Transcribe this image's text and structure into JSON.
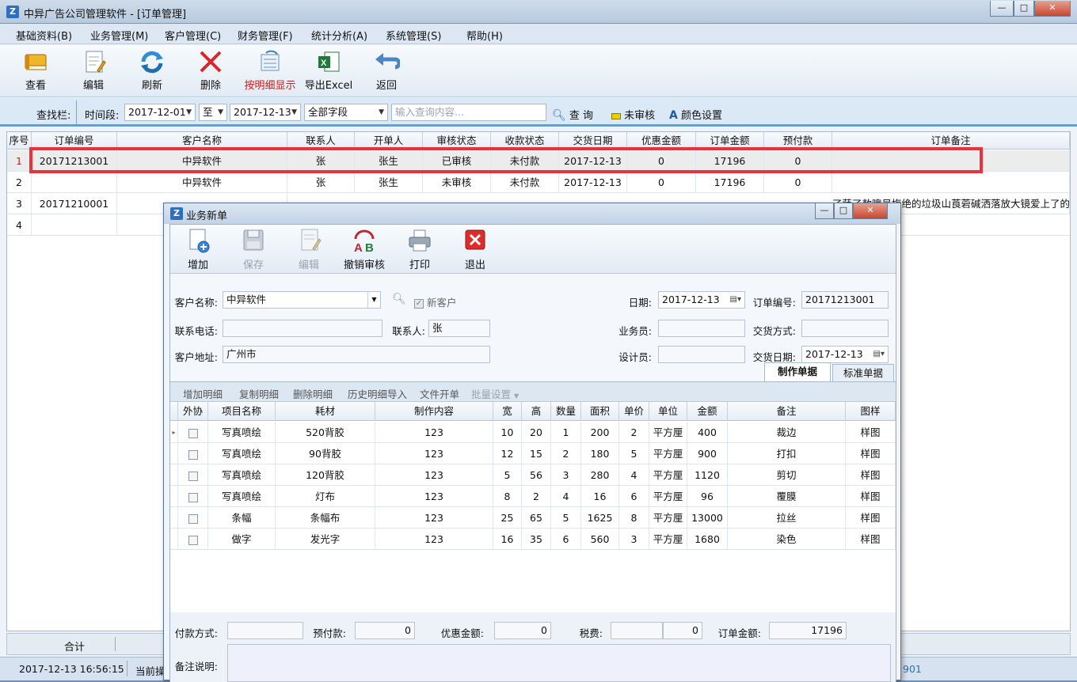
{
  "window": {
    "title": "中异广告公司管理软件 - [订单管理]",
    "app_icon": "Z",
    "btn_min": "—",
    "btn_max": "□",
    "btn_close": "✕"
  },
  "menu": [
    "基础资料(B)",
    "业务管理(M)",
    "客户管理(C)",
    "财务管理(F)",
    "统计分析(A)",
    "系统管理(S)",
    "帮助(H)"
  ],
  "toolbar": {
    "view": "查看",
    "edit": "编辑",
    "refresh": "刷新",
    "delete": "删除",
    "detail_show": "按明细显示",
    "export": "导出Excel",
    "back": "返回"
  },
  "search": {
    "bar_label": "查找栏:",
    "period_label": "时间段:",
    "date_from": "2017-12-01",
    "to_label": "至",
    "date_to": "2017-12-13",
    "field": "全部字段",
    "placeholder": "输入查询内容...",
    "query_btn": "查 询",
    "unreviewed": "未审核",
    "color_settings": "颜色设置"
  },
  "grid": {
    "headers": [
      "序号",
      "订单编号",
      "客户名称",
      "联系人",
      "开单人",
      "审核状态",
      "收款状态",
      "交货日期",
      "优惠金额",
      "订单金额",
      "预付款",
      "订单备注"
    ],
    "rows": [
      [
        "1",
        "20171213001",
        "中异软件",
        "张",
        "张生",
        "已审核",
        "未付款",
        "2017-12-13",
        "0",
        "17196",
        "0",
        ""
      ],
      [
        "2",
        "",
        "中异软件",
        "张",
        "张生",
        "未审核",
        "未付款",
        "2017-12-13",
        "0",
        "17196",
        "0",
        ""
      ],
      [
        "3",
        "20171210001",
        "",
        "",
        "",
        "",
        "",
        "",
        "",
        "",
        "",
        "了萨了敖噢吴梅绝的垃圾山莨菪碱洒落放大镜爱上了的"
      ],
      [
        "4",
        "",
        "",
        "",
        "",
        "",
        "",
        "",
        "",
        "",
        "",
        ""
      ]
    ],
    "sum_label": "合计"
  },
  "status": {
    "datetime": "2017-12-13 16:56:15",
    "current": "当前操",
    "right": "901"
  },
  "dialog": {
    "title": "业务新单",
    "toolbar": {
      "add": "增加",
      "save": "保存",
      "edit": "编辑",
      "cancel_review": "撤销审核",
      "print": "打印",
      "exit": "退出"
    },
    "form": {
      "customer_label": "客户名称:",
      "customer": "中异软件",
      "new_customer": "新客户",
      "date_label": "日期:",
      "date": "2017-12-13",
      "order_no_label": "订单编号:",
      "order_no": "20171213001",
      "phone_label": "联系电话:",
      "phone": "",
      "contact_label": "联系人:",
      "contact": "张",
      "sales_label": "业务员:",
      "sales": "",
      "delivery_method_label": "交货方式:",
      "delivery_method": "",
      "address_label": "客户地址:",
      "address": "广州市",
      "designer_label": "设计员:",
      "designer": "",
      "delivery_date_label": "交货日期:",
      "delivery_date": "2017-12-13"
    },
    "tabs": [
      "制作单据",
      "标准单据"
    ],
    "subtoolbar": [
      "增加明细",
      "复制明细",
      "删除明细",
      "历史明细导入",
      "文件开单",
      "批量设置"
    ],
    "detail_headers": [
      "外协",
      "项目名称",
      "耗材",
      "制作内容",
      "宽",
      "高",
      "数量",
      "面积",
      "单价",
      "单位",
      "金额",
      "备注",
      "图样"
    ],
    "detail_rows": [
      [
        "写真喷绘",
        "520背胶",
        "123",
        "10",
        "20",
        "1",
        "200",
        "2",
        "平方厘",
        "400",
        "裁边",
        "样图"
      ],
      [
        "写真喷绘",
        "90背胶",
        "123",
        "12",
        "15",
        "2",
        "180",
        "5",
        "平方厘",
        "900",
        "打扣",
        "样图"
      ],
      [
        "写真喷绘",
        "120背胶",
        "123",
        "5",
        "56",
        "3",
        "280",
        "4",
        "平方厘",
        "1120",
        "剪切",
        "样图"
      ],
      [
        "写真喷绘",
        "灯布",
        "123",
        "8",
        "2",
        "4",
        "16",
        "6",
        "平方厘",
        "96",
        "覆膜",
        "样图"
      ],
      [
        "条幅",
        "条幅布",
        "123",
        "25",
        "65",
        "5",
        "1625",
        "8",
        "平方厘",
        "13000",
        "拉丝",
        "样图"
      ],
      [
        "做字",
        "发光字",
        "123",
        "16",
        "35",
        "6",
        "560",
        "3",
        "平方厘",
        "1680",
        "染色",
        "样图"
      ]
    ],
    "footer": {
      "pay_method_label": "付款方式:",
      "pay_method": "",
      "prepay_label": "预付款:",
      "prepay": "0",
      "discount_label": "优惠金额:",
      "discount": "0",
      "tax_label": "税费:",
      "tax": "0",
      "total_label": "订单金额:",
      "total": "17196",
      "remark_label": "备注说明:",
      "remark": ""
    }
  }
}
